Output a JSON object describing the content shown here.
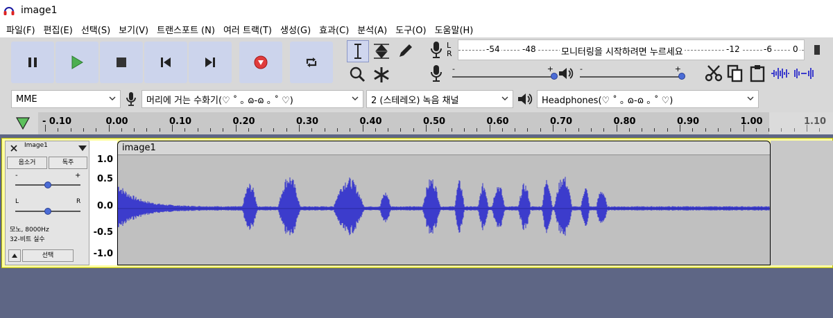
{
  "window": {
    "title": "image1",
    "accent": "#4040ff"
  },
  "menu": [
    "파일(F)",
    "편집(E)",
    "선택(S)",
    "보기(V)",
    "트랜스포트 (N)",
    "여러 트랙(T)",
    "생성(G)",
    "효과(C)",
    "분석(A)",
    "도구(O)",
    "도움말(H)"
  ],
  "transport": {
    "pause": "pause-icon",
    "play": "play-icon",
    "stop": "stop-icon",
    "skip_start": "skip-start-icon",
    "skip_end": "skip-end-icon",
    "record": "record-icon",
    "loop": "loop-icon"
  },
  "meters": {
    "record_channels": [
      "L",
      "R"
    ],
    "record_scale": [
      "-54",
      "-48",
      "-12",
      "-6",
      "0"
    ],
    "monitor_prompt": "모니터링을 시작하려면 누르세요",
    "record_slider_min": "-",
    "record_slider_max": "+",
    "playback_slider_min": "-",
    "playback_slider_max": "+"
  },
  "devices": {
    "host": "MME",
    "input": "머리에 거는 수화기(♡ ˚ ｡ ɷ-ɷ ｡ ˚ ♡)",
    "channels": "2 (스테레오) 녹음 채널",
    "output": "Headphones(♡ ˚ ｡ ɷ-ɷ ｡ ˚ ♡)"
  },
  "timeline": {
    "labels": [
      "- 0.10",
      "0.00",
      "0.10",
      "0.20",
      "0.30",
      "0.40",
      "0.50",
      "0.60",
      "0.70",
      "0.80",
      "0.90",
      "1.00",
      "1.10"
    ]
  },
  "track": {
    "name": "Image1",
    "mute": "음소거",
    "solo": "독주",
    "gain_min": "-",
    "gain_max": "+",
    "pan_left": "L",
    "pan_right": "R",
    "info_line1": "모노, 8000Hz",
    "info_line2": "32-비트 실수",
    "select": "선택",
    "clip_name": "image1",
    "scale": [
      "1.0",
      "0.5",
      "0.0",
      "-0.5",
      "-1.0"
    ],
    "wave_color": "#3c3ccc"
  }
}
